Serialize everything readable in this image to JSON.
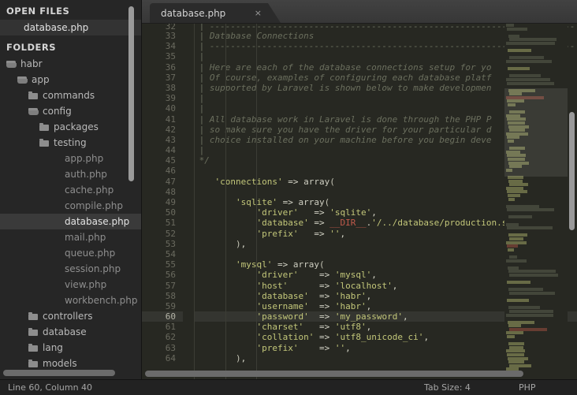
{
  "window": {
    "app": "Sublime Text",
    "theme_bg": "#272822",
    "sidebar_bg": "#262626",
    "accent": "#c3c77a"
  },
  "sidebar": {
    "open_files_title": "OPEN FILES",
    "folders_title": "FOLDERS",
    "open_files": [
      {
        "label": "database.php",
        "selected": true
      }
    ],
    "tree": [
      {
        "label": "habr",
        "type": "folder-open",
        "depth": 0,
        "selected": false
      },
      {
        "label": "app",
        "type": "folder-open",
        "depth": 1,
        "selected": false
      },
      {
        "label": "commands",
        "type": "folder-closed",
        "depth": 2,
        "selected": false
      },
      {
        "label": "config",
        "type": "folder-open",
        "depth": 2,
        "selected": false
      },
      {
        "label": "packages",
        "type": "folder-closed",
        "depth": 3,
        "selected": false
      },
      {
        "label": "testing",
        "type": "folder-closed",
        "depth": 3,
        "selected": false
      },
      {
        "label": "app.php",
        "type": "file",
        "depth": 4,
        "selected": false
      },
      {
        "label": "auth.php",
        "type": "file",
        "depth": 4,
        "selected": false
      },
      {
        "label": "cache.php",
        "type": "file",
        "depth": 4,
        "selected": false
      },
      {
        "label": "compile.php",
        "type": "file",
        "depth": 4,
        "selected": false
      },
      {
        "label": "database.php",
        "type": "file",
        "depth": 4,
        "selected": true
      },
      {
        "label": "mail.php",
        "type": "file",
        "depth": 4,
        "selected": false
      },
      {
        "label": "queue.php",
        "type": "file",
        "depth": 4,
        "selected": false
      },
      {
        "label": "session.php",
        "type": "file",
        "depth": 4,
        "selected": false
      },
      {
        "label": "view.php",
        "type": "file",
        "depth": 4,
        "selected": false
      },
      {
        "label": "workbench.php",
        "type": "file",
        "depth": 4,
        "selected": false
      },
      {
        "label": "controllers",
        "type": "folder-closed",
        "depth": 2,
        "selected": false
      },
      {
        "label": "database",
        "type": "folder-closed",
        "depth": 2,
        "selected": false
      },
      {
        "label": "lang",
        "type": "folder-closed",
        "depth": 2,
        "selected": false
      },
      {
        "label": "models",
        "type": "folder-closed",
        "depth": 2,
        "selected": false
      }
    ]
  },
  "tabs": [
    {
      "label": "database.php",
      "close_icon": "×",
      "active": true
    }
  ],
  "editor": {
    "first_line": 32,
    "active_line": 60,
    "lines": [
      {
        "n": 32,
        "tokens": [
          {
            "t": " | ----------------------------------------------------------------------",
            "c": "c-com"
          }
        ]
      },
      {
        "n": 33,
        "tokens": [
          {
            "t": " | Database Connections",
            "c": "c-com"
          }
        ]
      },
      {
        "n": 34,
        "tokens": [
          {
            "t": " | ----------------------------------------------------------------------",
            "c": "c-com"
          }
        ]
      },
      {
        "n": 35,
        "tokens": [
          {
            "t": " |",
            "c": "c-com"
          }
        ]
      },
      {
        "n": 36,
        "tokens": [
          {
            "t": " | Here are each of the database connections setup for yo",
            "c": "c-com"
          }
        ]
      },
      {
        "n": 37,
        "tokens": [
          {
            "t": " | Of course, examples of configuring each database platf",
            "c": "c-com"
          }
        ]
      },
      {
        "n": 38,
        "tokens": [
          {
            "t": " | supported by Laravel is shown below to make developmen",
            "c": "c-com"
          }
        ]
      },
      {
        "n": 39,
        "tokens": [
          {
            "t": " |",
            "c": "c-com"
          }
        ]
      },
      {
        "n": 40,
        "tokens": [
          {
            "t": " |",
            "c": "c-com"
          }
        ]
      },
      {
        "n": 41,
        "tokens": [
          {
            "t": " | All database work in Laravel is done through the PHP P",
            "c": "c-com"
          }
        ]
      },
      {
        "n": 42,
        "tokens": [
          {
            "t": " | so make sure you have the driver for your particular d",
            "c": "c-com"
          }
        ]
      },
      {
        "n": 43,
        "tokens": [
          {
            "t": " | choice installed on your machine before you begin deve",
            "c": "c-com"
          }
        ]
      },
      {
        "n": 44,
        "tokens": [
          {
            "t": " |",
            "c": "c-com"
          }
        ]
      },
      {
        "n": 45,
        "tokens": [
          {
            "t": " */",
            "c": "c-com"
          }
        ]
      },
      {
        "n": 46,
        "tokens": [
          {
            "t": "",
            "c": "c-plain"
          }
        ]
      },
      {
        "n": 47,
        "tokens": [
          {
            "t": "    ",
            "c": "c-plain"
          },
          {
            "t": "'connections'",
            "c": "c-str"
          },
          {
            "t": " => ",
            "c": "c-op"
          },
          {
            "t": "array",
            "c": "c-fn"
          },
          {
            "t": "(",
            "c": "c-paren"
          }
        ]
      },
      {
        "n": 48,
        "tokens": [
          {
            "t": "",
            "c": "c-plain"
          }
        ]
      },
      {
        "n": 49,
        "tokens": [
          {
            "t": "        ",
            "c": "c-plain"
          },
          {
            "t": "'sqlite'",
            "c": "c-str"
          },
          {
            "t": " => ",
            "c": "c-op"
          },
          {
            "t": "array",
            "c": "c-fn"
          },
          {
            "t": "(",
            "c": "c-paren"
          }
        ]
      },
      {
        "n": 50,
        "tokens": [
          {
            "t": "            ",
            "c": "c-plain"
          },
          {
            "t": "'driver'",
            "c": "c-str"
          },
          {
            "t": "   => ",
            "c": "c-op"
          },
          {
            "t": "'sqlite'",
            "c": "c-str"
          },
          {
            "t": ",",
            "c": "c-op"
          }
        ]
      },
      {
        "n": 51,
        "tokens": [
          {
            "t": "            ",
            "c": "c-plain"
          },
          {
            "t": "'database'",
            "c": "c-str"
          },
          {
            "t": " => ",
            "c": "c-op"
          },
          {
            "t": "__DIR__",
            "c": "c-const"
          },
          {
            "t": ".",
            "c": "c-op"
          },
          {
            "t": "'/../database/production.s",
            "c": "c-str"
          }
        ]
      },
      {
        "n": 52,
        "tokens": [
          {
            "t": "            ",
            "c": "c-plain"
          },
          {
            "t": "'prefix'",
            "c": "c-str"
          },
          {
            "t": "   => ",
            "c": "c-op"
          },
          {
            "t": "''",
            "c": "c-str"
          },
          {
            "t": ",",
            "c": "c-op"
          }
        ]
      },
      {
        "n": 53,
        "tokens": [
          {
            "t": "        ",
            "c": "c-plain"
          },
          {
            "t": ")",
            "c": "c-paren"
          },
          {
            "t": ",",
            "c": "c-op"
          }
        ]
      },
      {
        "n": 54,
        "tokens": [
          {
            "t": "",
            "c": "c-plain"
          }
        ]
      },
      {
        "n": 55,
        "tokens": [
          {
            "t": "        ",
            "c": "c-plain"
          },
          {
            "t": "'mysql'",
            "c": "c-str"
          },
          {
            "t": " => ",
            "c": "c-op"
          },
          {
            "t": "array",
            "c": "c-fn"
          },
          {
            "t": "(",
            "c": "c-paren"
          }
        ]
      },
      {
        "n": 56,
        "tokens": [
          {
            "t": "            ",
            "c": "c-plain"
          },
          {
            "t": "'driver'",
            "c": "c-str"
          },
          {
            "t": "    => ",
            "c": "c-op"
          },
          {
            "t": "'mysql'",
            "c": "c-str"
          },
          {
            "t": ",",
            "c": "c-op"
          }
        ]
      },
      {
        "n": 57,
        "tokens": [
          {
            "t": "            ",
            "c": "c-plain"
          },
          {
            "t": "'host'",
            "c": "c-str"
          },
          {
            "t": "      => ",
            "c": "c-op"
          },
          {
            "t": "'localhost'",
            "c": "c-str"
          },
          {
            "t": ",",
            "c": "c-op"
          }
        ]
      },
      {
        "n": 58,
        "tokens": [
          {
            "t": "            ",
            "c": "c-plain"
          },
          {
            "t": "'database'",
            "c": "c-str"
          },
          {
            "t": "  => ",
            "c": "c-op"
          },
          {
            "t": "'habr'",
            "c": "c-str"
          },
          {
            "t": ",",
            "c": "c-op"
          }
        ]
      },
      {
        "n": 59,
        "tokens": [
          {
            "t": "            ",
            "c": "c-plain"
          },
          {
            "t": "'username'",
            "c": "c-str"
          },
          {
            "t": "  => ",
            "c": "c-op"
          },
          {
            "t": "'habr'",
            "c": "c-str"
          },
          {
            "t": ",",
            "c": "c-op"
          }
        ]
      },
      {
        "n": 60,
        "tokens": [
          {
            "t": "            ",
            "c": "c-plain"
          },
          {
            "t": "'password'",
            "c": "c-str"
          },
          {
            "t": "  => ",
            "c": "c-op"
          },
          {
            "t": "'my_password'",
            "c": "c-str"
          },
          {
            "t": ",",
            "c": "c-op"
          }
        ],
        "active": true
      },
      {
        "n": 61,
        "tokens": [
          {
            "t": "            ",
            "c": "c-plain"
          },
          {
            "t": "'charset'",
            "c": "c-str"
          },
          {
            "t": "   => ",
            "c": "c-op"
          },
          {
            "t": "'utf8'",
            "c": "c-str"
          },
          {
            "t": ",",
            "c": "c-op"
          }
        ]
      },
      {
        "n": 62,
        "tokens": [
          {
            "t": "            ",
            "c": "c-plain"
          },
          {
            "t": "'collation'",
            "c": "c-str"
          },
          {
            "t": " => ",
            "c": "c-op"
          },
          {
            "t": "'utf8_unicode_ci'",
            "c": "c-str"
          },
          {
            "t": ",",
            "c": "c-op"
          }
        ]
      },
      {
        "n": 63,
        "tokens": [
          {
            "t": "            ",
            "c": "c-plain"
          },
          {
            "t": "'prefix'",
            "c": "c-str"
          },
          {
            "t": "    => ",
            "c": "c-op"
          },
          {
            "t": "''",
            "c": "c-str"
          },
          {
            "t": ",",
            "c": "c-op"
          }
        ]
      },
      {
        "n": 64,
        "tokens": [
          {
            "t": "        ",
            "c": "c-plain"
          },
          {
            "t": ")",
            "c": "c-paren"
          },
          {
            "t": ",",
            "c": "c-op"
          }
        ]
      }
    ]
  },
  "statusbar": {
    "position": "Line 60, Column 40",
    "tab_size": "Tab Size: 4",
    "syntax": "PHP"
  }
}
